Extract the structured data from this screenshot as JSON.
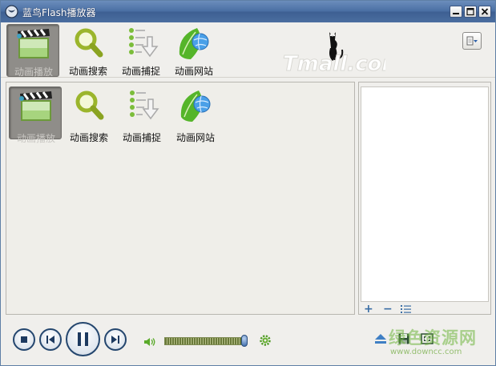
{
  "window": {
    "title": "蓝鸟Flash播放器",
    "controls": [
      "minimize",
      "maximize",
      "close"
    ]
  },
  "toolbar": {
    "items": [
      {
        "label": "动画播放",
        "icon": "clapperboard-icon",
        "active": true
      },
      {
        "label": "动画搜索",
        "icon": "magnifier-icon",
        "active": false
      },
      {
        "label": "动画捕捉",
        "icon": "capture-list-icon",
        "active": false
      },
      {
        "label": "动画网站",
        "icon": "globe-leaf-icon",
        "active": false
      }
    ],
    "logo_text": "Tmall.com",
    "menu_icon": "menu-dropdown-icon"
  },
  "main": {
    "items": [
      {
        "label": "动画播放",
        "icon": "clapperboard-icon",
        "active": true
      },
      {
        "label": "动画搜索",
        "icon": "magnifier-icon",
        "active": false
      },
      {
        "label": "动画捕捉",
        "icon": "capture-list-icon",
        "active": false
      },
      {
        "label": "动画网站",
        "icon": "globe-leaf-icon",
        "active": false
      }
    ]
  },
  "playlist": {
    "add_symbol": "+",
    "remove_symbol": "−",
    "list_icon": "list-icon",
    "entries": []
  },
  "controls": {
    "buttons": [
      "stop-icon",
      "previous-icon",
      "pause-icon",
      "next-icon"
    ],
    "volume_level": 0.97,
    "extra_icons": [
      "settings-icon",
      "eject-icon",
      "save-icon",
      "fullscreen-icon"
    ]
  },
  "watermark": {
    "text": "绿色资源网",
    "url": "www.downcc.com"
  },
  "colors": {
    "titlebar": "#4a6fa3",
    "window_bg": "#f0efec",
    "control_ring": "#24466e",
    "accent_green": "#6eb43c"
  }
}
